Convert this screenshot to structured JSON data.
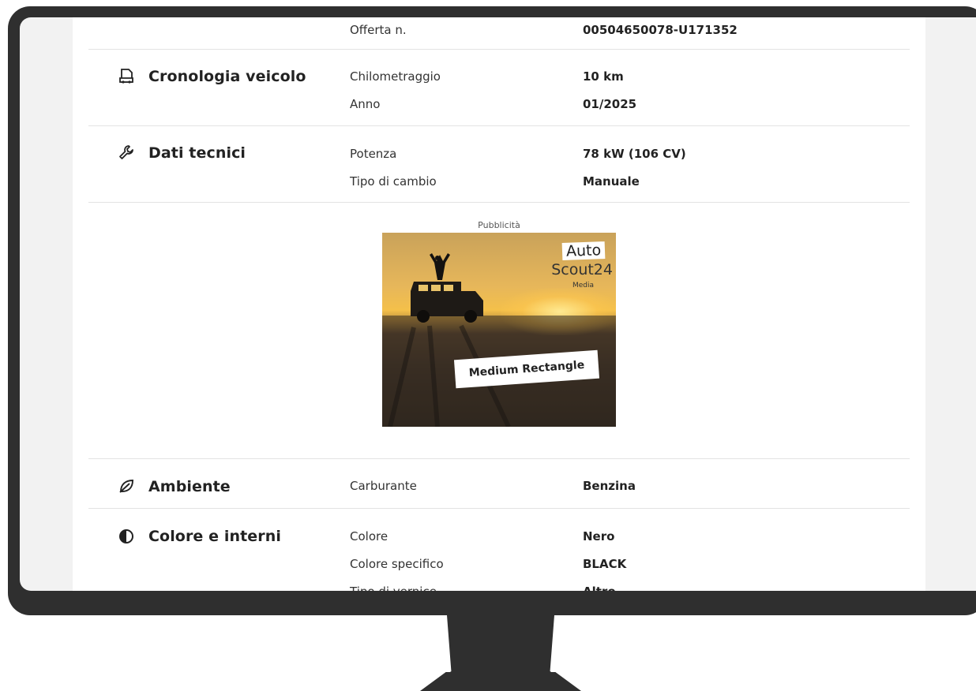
{
  "rows": {
    "offer": {
      "label": "Offerta n.",
      "value": "00504650078-U171352"
    },
    "history": {
      "title": "Cronologia veicolo",
      "icon": "vehicle-history-icon",
      "items": [
        {
          "label": "Chilometraggio",
          "value": "10 km"
        },
        {
          "label": "Anno",
          "value": "01/2025"
        }
      ]
    },
    "technical": {
      "title": "Dati tecnici",
      "icon": "wrench-icon",
      "items": [
        {
          "label": "Potenza",
          "value": "78 kW (106 CV)"
        },
        {
          "label": "Tipo di cambio",
          "value": "Manuale"
        }
      ]
    },
    "environment": {
      "title": "Ambiente",
      "icon": "leaf-icon",
      "items": [
        {
          "label": "Carburante",
          "value": "Benzina"
        }
      ]
    },
    "color": {
      "title": "Colore e interni",
      "icon": "half-circle-icon",
      "items": [
        {
          "label": "Colore",
          "value": "Nero"
        },
        {
          "label": "Colore specifico",
          "value": "BLACK"
        },
        {
          "label": "Tipo di vernice",
          "value": "Altro"
        }
      ]
    }
  },
  "ad": {
    "caption": "Pubblicità",
    "logo_line1": "Auto",
    "logo_line2": "Scout24",
    "logo_line3": "Media",
    "sticker": "Medium Rectangle"
  },
  "colors": {
    "bezel": "#2f2f2f",
    "divider": "#e3e3e3",
    "text": "#222222"
  }
}
